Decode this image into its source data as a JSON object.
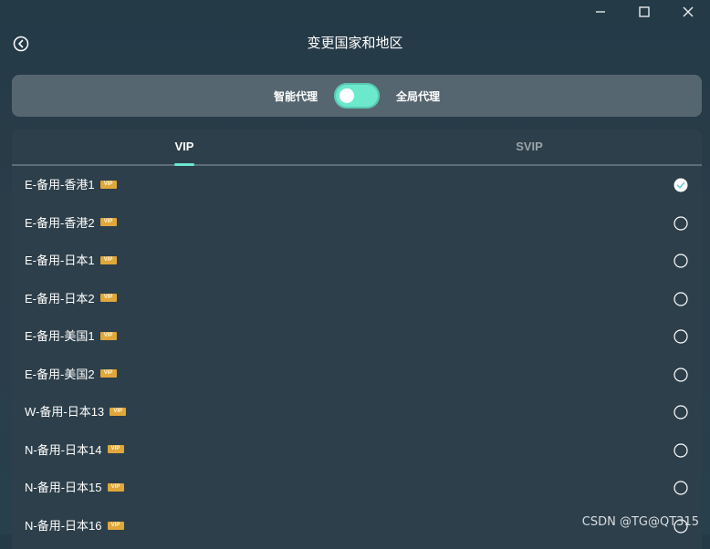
{
  "window": {
    "controls": [
      "minimize-icon",
      "maximize-icon",
      "close-icon"
    ]
  },
  "header": {
    "title": "变更国家和地区",
    "back_icon": "back-circle-icon"
  },
  "mode": {
    "smart_label": "智能代理",
    "global_label": "全局代理",
    "toggle_color": "#6ce9cd"
  },
  "tabs": [
    {
      "label": "VIP",
      "active": true
    },
    {
      "label": "SVIP",
      "active": false
    }
  ],
  "servers": [
    {
      "name": "E-备用-香港1",
      "badge": "VIP",
      "selected": true
    },
    {
      "name": "E-备用-香港2",
      "badge": "VIP",
      "selected": false
    },
    {
      "name": "E-备用-日本1",
      "badge": "VIP",
      "selected": false
    },
    {
      "name": "E-备用-日本2",
      "badge": "VIP",
      "selected": false
    },
    {
      "name": "E-备用-美国1",
      "badge": "VIP",
      "selected": false
    },
    {
      "name": "E-备用-美国2",
      "badge": "VIP",
      "selected": false
    },
    {
      "name": "W-备用-日本13",
      "badge": "VIP",
      "selected": false
    },
    {
      "name": "N-备用-日本14",
      "badge": "VIP",
      "selected": false
    },
    {
      "name": "N-备用-日本15",
      "badge": "VIP",
      "selected": false
    },
    {
      "name": "N-备用-日本16",
      "badge": "VIP",
      "selected": false
    }
  ],
  "watermark": "CSDN @TG@QT315"
}
